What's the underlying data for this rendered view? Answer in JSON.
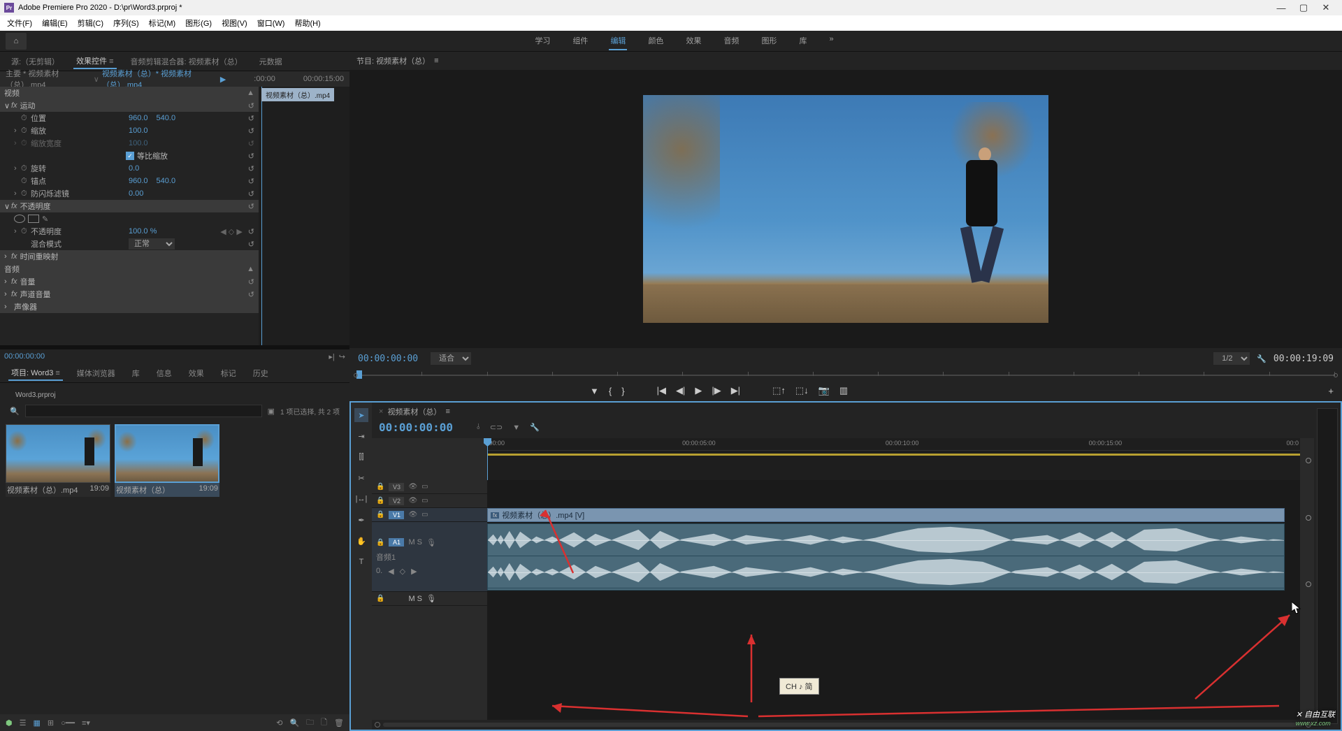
{
  "titlebar": {
    "icon_text": "Pr",
    "title": "Adobe Premiere Pro 2020 - D:\\pr\\Word3.prproj *"
  },
  "menubar": [
    "文件(F)",
    "编辑(E)",
    "剪辑(C)",
    "序列(S)",
    "标记(M)",
    "图形(G)",
    "视图(V)",
    "窗口(W)",
    "帮助(H)"
  ],
  "workspaces": {
    "items": [
      "学习",
      "组件",
      "编辑",
      "颜色",
      "效果",
      "音频",
      "图形",
      "库"
    ],
    "active_index": 2
  },
  "source_tabs": {
    "items": [
      "源:（无剪辑）",
      "效果控件",
      "音频剪辑混合器: 视频素材（总）",
      "元数据"
    ],
    "active_index": 1
  },
  "effects_header": {
    "crumb1": "主要 * 视频素材（总）.mp4",
    "crumb2": "视频素材（总）* 视频素材（总）.mp4",
    "time_start": ":00:00",
    "time_end": "00:00:15:00",
    "clip_label": "视频素材（总）.mp4"
  },
  "fx": {
    "video_header": "视频",
    "motion": {
      "title": "运动",
      "position": {
        "label": "位置",
        "x": "960.0",
        "y": "540.0"
      },
      "scale": {
        "label": "缩放",
        "val": "100.0"
      },
      "scale_width": {
        "label": "缩放宽度",
        "val": "100.0"
      },
      "uniform": {
        "label": "等比缩放"
      },
      "rotation": {
        "label": "旋转",
        "val": "0.0"
      },
      "anchor": {
        "label": "锚点",
        "x": "960.0",
        "y": "540.0"
      },
      "flicker": {
        "label": "防闪烁滤镜",
        "val": "0.00"
      }
    },
    "opacity": {
      "title": "不透明度",
      "opacity": {
        "label": "不透明度",
        "val": "100.0 %"
      },
      "blend": {
        "label": "混合模式",
        "val": "正常"
      }
    },
    "time_remap": {
      "title": "时间重映射"
    },
    "audio_header": "音频",
    "volume": {
      "title": "音量"
    },
    "channel_volume": {
      "title": "声道音量"
    },
    "panner": {
      "title": "声像器"
    }
  },
  "effects_tc": "00:00:00:00",
  "project": {
    "tabs": [
      "项目: Word3",
      "媒体浏览器",
      "库",
      "信息",
      "效果",
      "标记",
      "历史"
    ],
    "active_index": 0,
    "name": "Word3.prproj",
    "status": "1 项已选择, 共 2 项",
    "thumbs": [
      {
        "label": "视频素材（总）.mp4",
        "dur": "19:09"
      },
      {
        "label": "视频素材（总）",
        "dur": "19:09"
      }
    ]
  },
  "program": {
    "title": "节目: 视频素材（总）",
    "tc": "00:00:00:00",
    "fit": "适合",
    "zoom": "1/2",
    "duration": "00:00:19:09"
  },
  "timeline": {
    "seq_name": "视频素材（总）",
    "tc": "00:00:00:00",
    "ruler": [
      ":00:00",
      "00:00:05:00",
      "00:00:10:00",
      "00:00:15:00",
      "00:0"
    ],
    "tracks": {
      "v3": "V3",
      "v2": "V2",
      "v1": "V1",
      "a1": "A1",
      "a1_name": "音频1",
      "a1_vol": "0.",
      "ms": "M  S"
    },
    "clip_name": "视频素材（总）.mp4 [V]",
    "fx_badge": "fx"
  },
  "tooltip": "CH ♪ 简",
  "watermark": {
    "main": "自由互联",
    "sub": "www.xz.com"
  }
}
